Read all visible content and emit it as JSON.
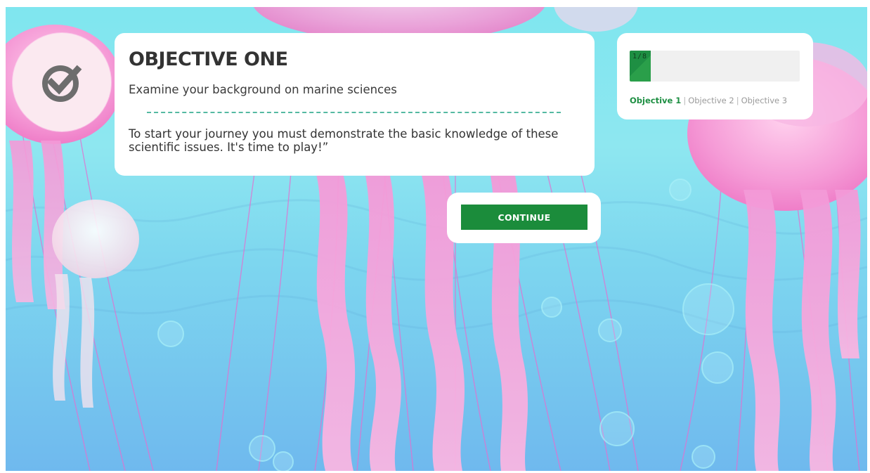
{
  "objective": {
    "title": "OBJECTIVE ONE",
    "subtitle": "Examine your background on marine sciences",
    "description": "To start your journey you must demonstrate the basic knowledge of these scientific issues. It's time to play!”"
  },
  "badge": {
    "icon": "checkmark-circle-icon"
  },
  "continue_label": "CONTINUE",
  "progress": {
    "label": "1/8",
    "current": 1,
    "total": 8,
    "fill_fraction": 0.125,
    "objectives": [
      {
        "label": "Objective 1",
        "active": true
      },
      {
        "label": "Objective 2",
        "active": false
      },
      {
        "label": "Objective 3",
        "active": false
      }
    ],
    "separator": "|"
  },
  "colors": {
    "accent_green": "#1b8c3b",
    "dash_teal": "#55b9a2",
    "water_top": "#7fe6ef",
    "water_bottom": "#6fb9ee",
    "jellyfish_pink": "#f48fd0"
  }
}
